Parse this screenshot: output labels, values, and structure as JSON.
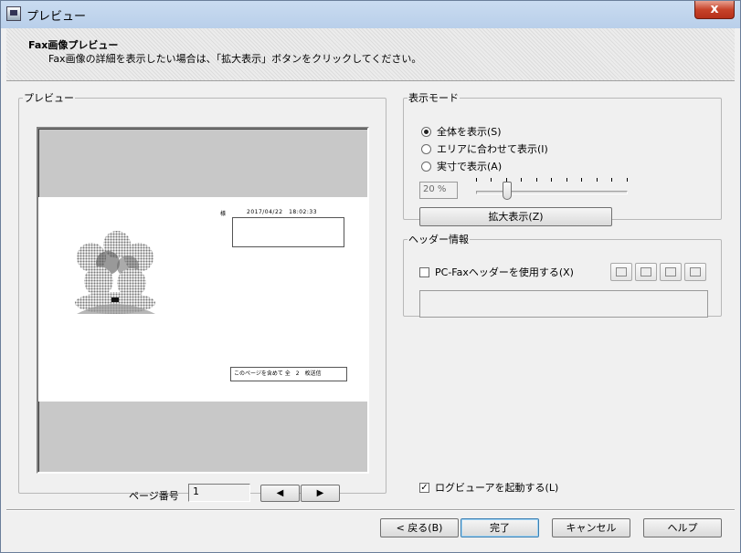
{
  "window": {
    "title": "プレビュー",
    "close_glyph": "x"
  },
  "header": {
    "title": "Fax画像プレビュー",
    "description": "Fax画像の詳細を表示したい場合は、「拡大表示」ボタンをクリックしてください。"
  },
  "preview": {
    "group_label": "プレビュー",
    "page": {
      "label": "様",
      "datetime": "2017/04/22　18:02:33",
      "footer": "このページを含めて 全　2　枚送信"
    },
    "page_number_label": "ページ番号",
    "page_number_value": "1",
    "prev_glyph": "◀",
    "next_glyph": "▶"
  },
  "display_mode": {
    "group_label": "表示モード",
    "options": [
      {
        "label": "全体を表示(S)",
        "selected": true
      },
      {
        "label": "エリアに合わせて表示(I)",
        "selected": false
      },
      {
        "label": "実寸で表示(A)",
        "selected": false
      }
    ],
    "zoom_value": "20 %",
    "zoom_level_fraction": 0.2,
    "zoom_button": "拡大表示(Z)"
  },
  "header_info": {
    "group_label": "ヘッダー情報",
    "use_header_label": "PC-Faxヘッダーを使用する(X)",
    "use_header_checked": false,
    "header_text": "",
    "icons": [
      "calendar-icon",
      "business-card-icon",
      "fax-machine-icon",
      "book-icon"
    ]
  },
  "launch_log_viewer": {
    "label": "ログビューアを起動する(L)",
    "checked": true
  },
  "footer_buttons": {
    "back": "< 戻る(B)",
    "finish": "完了",
    "cancel": "キャンセル",
    "help": "ヘルプ"
  }
}
